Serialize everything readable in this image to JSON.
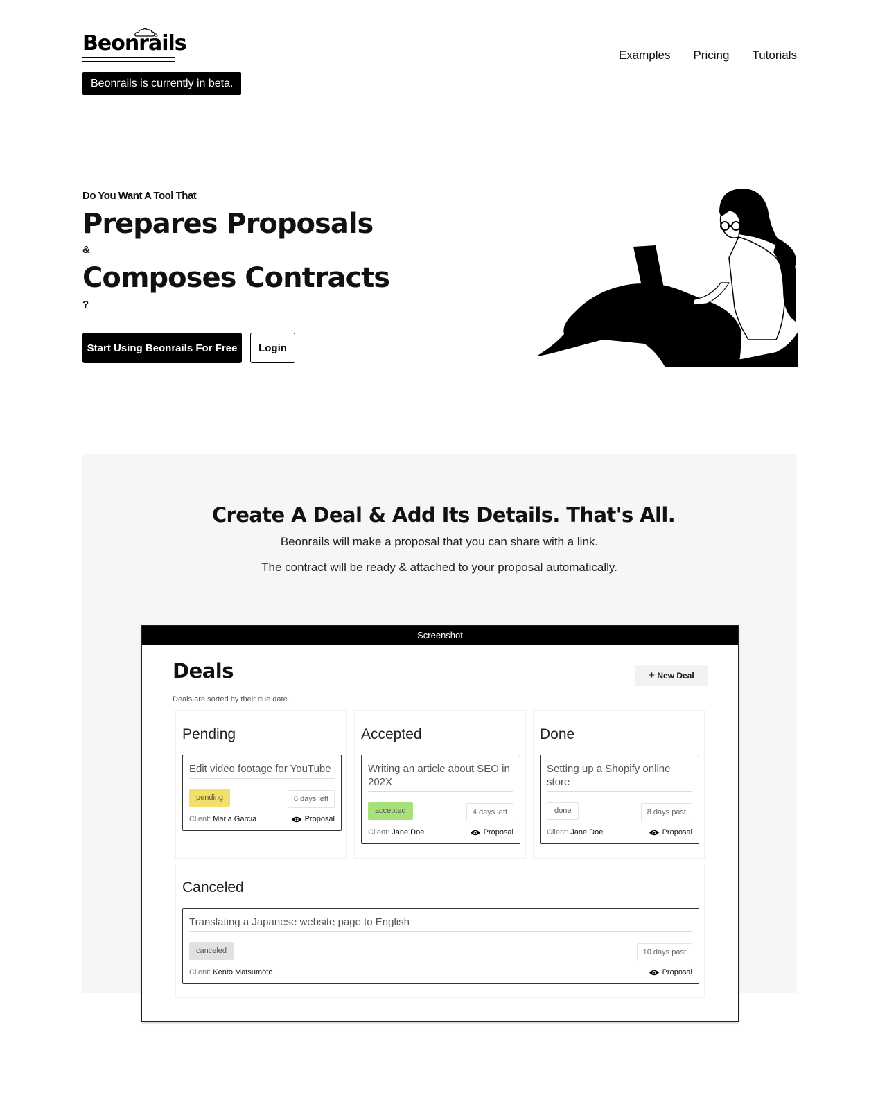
{
  "header": {
    "logo_text": "Beonrails",
    "beta_text": "Beonrails is currently in beta.",
    "nav": [
      "Examples",
      "Pricing",
      "Tutorials"
    ]
  },
  "hero": {
    "eyebrow": "Do You Want A Tool That",
    "line1": "Prepares Proposals",
    "amp": "&",
    "line2": "Composes Contracts",
    "question": "?",
    "cta_primary": "Start Using Beonrails For Free",
    "cta_login": "Login"
  },
  "section": {
    "title": "Create A Deal & Add Its Details. That's All.",
    "sub1": "Beonrails will make a proposal that you can share with a link.",
    "sub2": "The contract will be ready & attached to your proposal automatically."
  },
  "screenshot": {
    "bar_label": "Screenshot",
    "title": "Deals",
    "note": "Deals are sorted by their due date.",
    "new_deal": "New Deal",
    "client_label": "Client:",
    "proposal_label": "Proposal",
    "columns": [
      {
        "title": "Pending",
        "card": {
          "title": "Edit video footage for YouTube",
          "status": "pending",
          "days": "6 days left",
          "client": "Maria Garcia"
        }
      },
      {
        "title": "Accepted",
        "card": {
          "title": "Writing an article about SEO in 202X",
          "status": "accepted",
          "days": "4 days left",
          "client": "Jane Doe"
        }
      },
      {
        "title": "Done",
        "card": {
          "title": "Setting up a Shopify online store",
          "status": "done",
          "days": "8 days past",
          "client": "Jane Doe"
        }
      },
      {
        "title": "Canceled",
        "card": {
          "title": "Translating a Japanese website page to English",
          "status": "canceled",
          "days": "10 days past",
          "client": "Kento Matsumoto"
        }
      }
    ]
  },
  "colors": {
    "pending": "#f2e06a",
    "accepted": "#a8e07a",
    "done": "#ffffff",
    "canceled": "#dfe1e3",
    "section_bg": "#f6f6f6"
  }
}
